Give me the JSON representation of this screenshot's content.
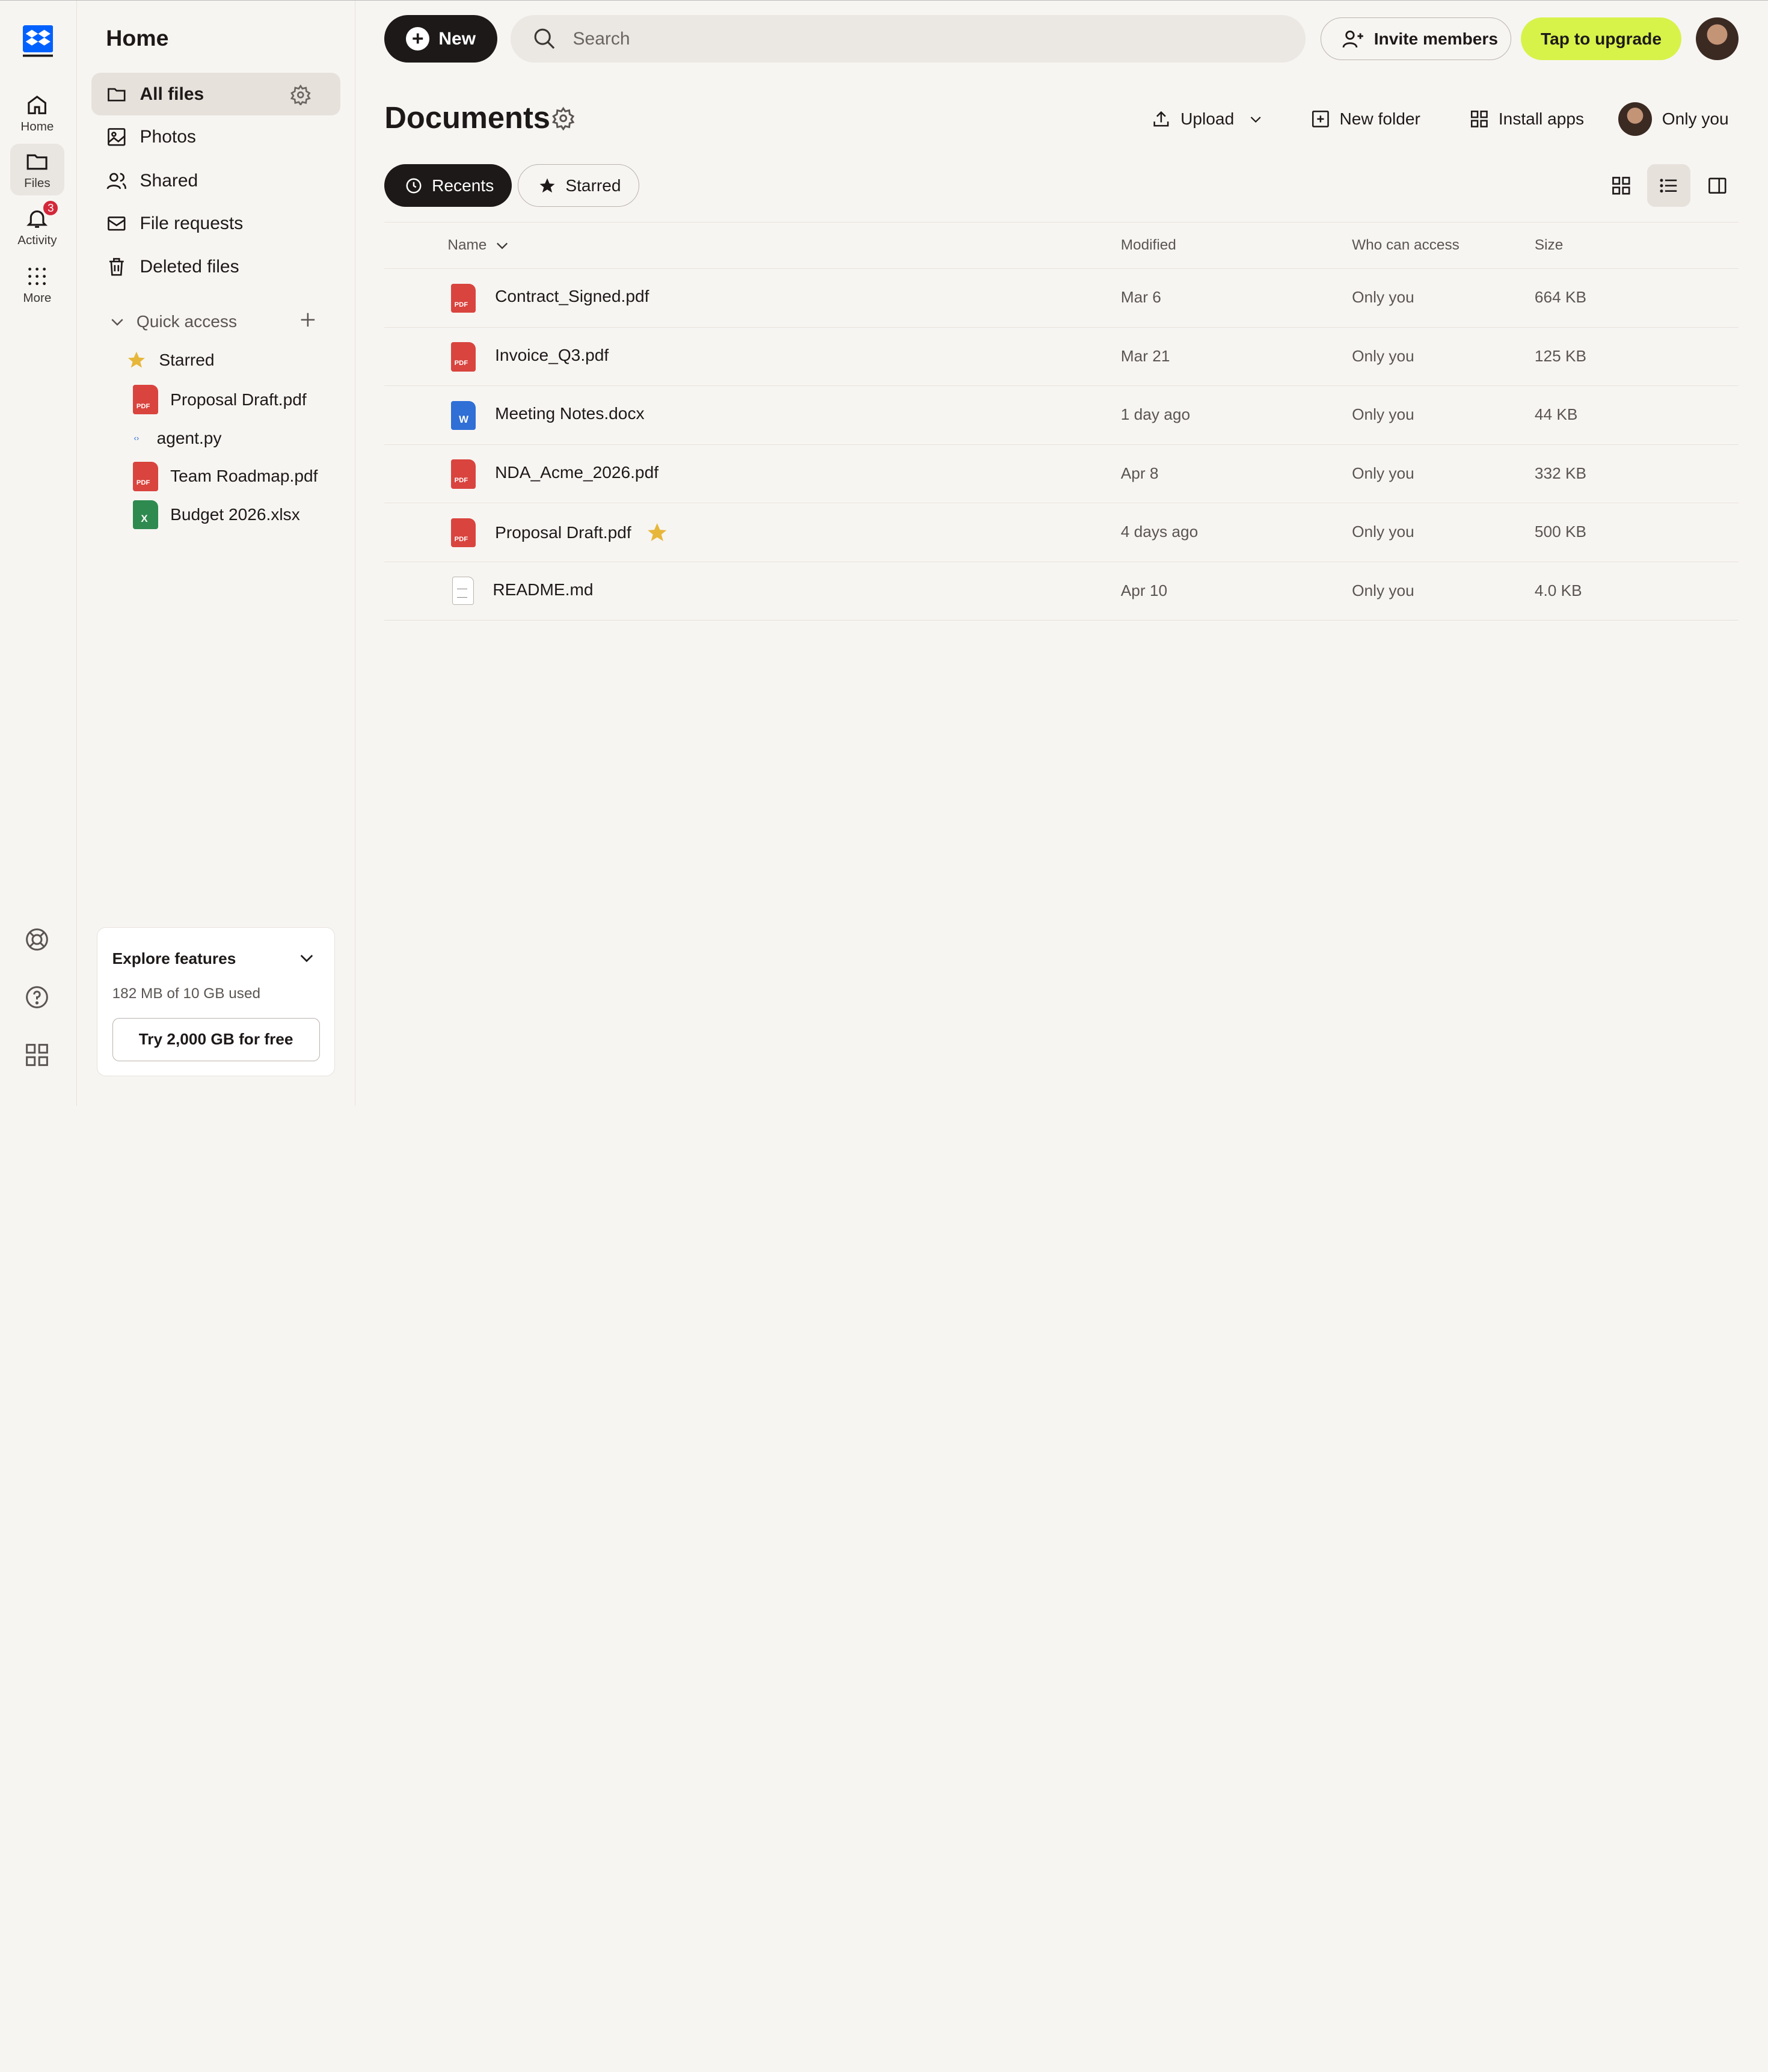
{
  "rail": {
    "items": [
      {
        "label": "Home",
        "icon": "home-icon"
      },
      {
        "label": "Files",
        "icon": "folder-icon"
      },
      {
        "label": "Activity",
        "icon": "bell-icon",
        "badge": "3"
      },
      {
        "label": "More",
        "icon": "grid-dots-icon"
      }
    ]
  },
  "sidebar": {
    "title": "Home",
    "nav": [
      {
        "label": "All files",
        "icon": "folder-icon"
      },
      {
        "label": "Photos",
        "icon": "image-icon"
      },
      {
        "label": "Shared",
        "icon": "people-icon"
      },
      {
        "label": "File requests",
        "icon": "inbox-icon"
      },
      {
        "label": "Deleted files",
        "icon": "trash-icon"
      }
    ],
    "quick_access": {
      "label": "Quick access",
      "items": [
        {
          "label": "Starred",
          "icon": "star-icon"
        },
        {
          "label": "Proposal Draft.pdf",
          "icon": "pdf-icon"
        },
        {
          "label": "agent.py",
          "icon": "code-file-icon"
        },
        {
          "label": "Team Roadmap.pdf",
          "icon": "pdf-icon"
        },
        {
          "label": "Budget 2026.xlsx",
          "icon": "excel-icon"
        }
      ]
    },
    "explore": {
      "title": "Explore features",
      "usage": "182 MB of 10 GB used",
      "button": "Try 2,000 GB for free"
    }
  },
  "topbar": {
    "new_label": "New",
    "search_placeholder": "Search",
    "invite_label": "Invite members",
    "upgrade_label": "Tap to upgrade"
  },
  "documents": {
    "title": "Documents",
    "actions": {
      "upload": "Upload",
      "new_folder": "New folder",
      "install_apps": "Install apps",
      "access": "Only you"
    },
    "filters": {
      "recents": "Recents",
      "starred": "Starred"
    },
    "columns": {
      "name": "Name",
      "modified": "Modified",
      "who": "Who can access",
      "size": "Size"
    },
    "rows": [
      {
        "name": "Contract_Signed.pdf",
        "type": "pdf",
        "modified": "Mar 6",
        "who": "Only you",
        "size": "664 KB",
        "starred": false
      },
      {
        "name": "Invoice_Q3.pdf",
        "type": "pdf",
        "modified": "Mar 21",
        "who": "Only you",
        "size": "125 KB",
        "starred": false
      },
      {
        "name": "Meeting Notes.docx",
        "type": "docx",
        "modified": "1 day ago",
        "who": "Only you",
        "size": "44 KB",
        "starred": false
      },
      {
        "name": "NDA_Acme_2026.pdf",
        "type": "pdf",
        "modified": "Apr 8",
        "who": "Only you",
        "size": "332 KB",
        "starred": false
      },
      {
        "name": "Proposal Draft.pdf",
        "type": "pdf",
        "modified": "4 days ago",
        "who": "Only you",
        "size": "500 KB",
        "starred": true
      },
      {
        "name": "README.md",
        "type": "md",
        "modified": "Apr 10",
        "who": "Only you",
        "size": "4.0 KB",
        "starred": false
      }
    ]
  },
  "colors": {
    "accent_dark": "#1e1919",
    "upgrade": "#d7f34a",
    "badge": "#d3283a",
    "brand_blue": "#0061fe",
    "star": "#e7b73b"
  }
}
